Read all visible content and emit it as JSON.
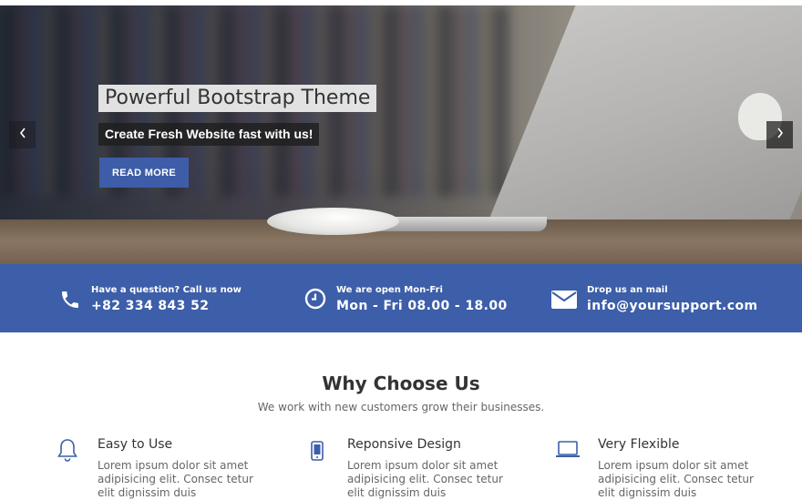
{
  "hero": {
    "title": "Powerful Bootstrap Theme",
    "subtitle": "Create Fresh Website fast with us!",
    "button_label": "READ MORE",
    "prev_icon": "chevron-left-icon",
    "next_icon": "chevron-right-icon"
  },
  "info_bar": {
    "color": "#3d5ea8",
    "items": [
      {
        "icon": "phone-icon",
        "label": "Have a question? Call us now",
        "value": "+82 334 843 52"
      },
      {
        "icon": "clock-icon",
        "label": "We are open Mon-Fri",
        "value": "Mon - Fri 08.00 - 18.00"
      },
      {
        "icon": "envelope-icon",
        "label": "Drop us an mail",
        "value": "info@yoursupport.com"
      }
    ]
  },
  "why": {
    "title": "Why Choose Us",
    "subtitle": "We work with new customers grow their businesses.",
    "features": [
      {
        "icon": "bell-icon",
        "title": "Easy to Use",
        "text": "Lorem ipsum dolor sit amet adipisicing elit. Consec tetur elit dignissim duis"
      },
      {
        "icon": "mobile-icon",
        "title": "Reponsive Design",
        "text": "Lorem ipsum dolor sit amet adipisicing elit. Consec tetur elit dignissim duis"
      },
      {
        "icon": "laptop-icon",
        "title": "Very Flexible",
        "text": "Lorem ipsum dolor sit amet adipisicing elit. Consec tetur elit dignissim duis"
      }
    ]
  },
  "colors": {
    "accent": "#3d5ea8",
    "button": "#3d5da8",
    "icon_blue": "#3d5ea8"
  }
}
